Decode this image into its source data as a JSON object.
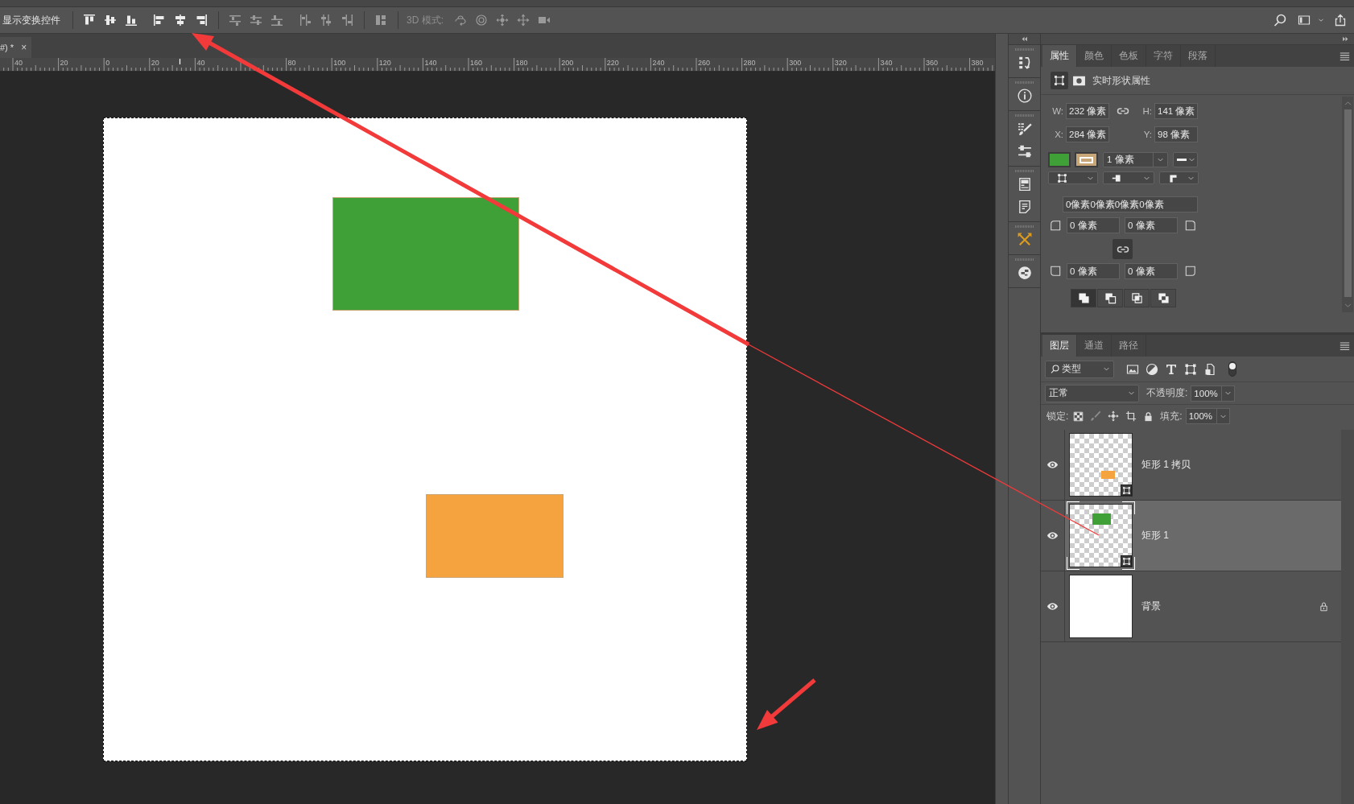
{
  "toolbar": {
    "transform_controls_label": "显示变换控件",
    "button_groups": [
      {
        "kind": "align",
        "disabled": false
      },
      {
        "kind": "distribute",
        "disabled": true
      },
      {
        "kind": "auto_align",
        "disabled": true
      }
    ],
    "mode_3d": {
      "label": "3D 模式:",
      "disabled": true
    }
  },
  "document_tab": {
    "title": "#) *",
    "close": "×"
  },
  "ruler": {
    "labels": [
      "40",
      "20",
      "0",
      "20",
      "40"
    ],
    "labels_past_arrow": [
      "80",
      "100",
      "120",
      "140",
      "160",
      "180",
      "200",
      "220",
      "240",
      "260",
      "280",
      "300",
      "320",
      "340",
      "360",
      "380"
    ]
  },
  "properties_panel": {
    "tabs": [
      {
        "label": "属性",
        "selected": true
      },
      {
        "label": "颜色",
        "selected": false
      },
      {
        "label": "色板",
        "selected": false
      },
      {
        "label": "字符",
        "selected": false
      },
      {
        "label": "段落",
        "selected": false
      }
    ],
    "title": "实时形状属性",
    "size": [
      {
        "label": "W:",
        "value": "232 像素"
      },
      {
        "label": "H:",
        "value": "141 像素"
      }
    ],
    "position": [
      {
        "label": "X:",
        "value": "284 像素"
      },
      {
        "label": "Y:",
        "value": "98 像素"
      }
    ],
    "swatches": [
      {
        "kind": "fill",
        "color": "#40a038"
      },
      {
        "kind": "stroke",
        "color": "#c9a677"
      }
    ],
    "stroke_width": "1 像素",
    "corner_radii_summary": "0像素0像素0像素0像素",
    "corner_radii": [
      "0 像素",
      "0 像素",
      "0 像素",
      "0 像素"
    ],
    "path_operations": [
      {
        "kind": "combine",
        "selected": true
      },
      {
        "kind": "subtract",
        "selected": false
      },
      {
        "kind": "intersect",
        "selected": false
      },
      {
        "kind": "exclude",
        "selected": false
      }
    ]
  },
  "layers_panel": {
    "tabs": [
      {
        "label": "图层",
        "selected": true
      },
      {
        "label": "通道",
        "selected": false
      },
      {
        "label": "路径",
        "selected": false
      }
    ],
    "filter": {
      "value": "类型",
      "enabled": true
    },
    "blend_mode": "正常",
    "opacity": {
      "label": "不透明度:",
      "value": "100%"
    },
    "lock_label": "锁定:",
    "fill": {
      "label": "填充:",
      "value": "100%"
    },
    "layers": [
      {
        "name": "矩形 1 拷贝",
        "kind": "shape",
        "color": "#f5a33f",
        "visible": true,
        "selected": false,
        "locked": false
      },
      {
        "name": "矩形 1",
        "kind": "shape",
        "color": "#40a038",
        "visible": true,
        "selected": true,
        "locked": false
      },
      {
        "name": "背景",
        "kind": "background",
        "visible": true,
        "selected": false,
        "locked": true
      }
    ]
  }
}
